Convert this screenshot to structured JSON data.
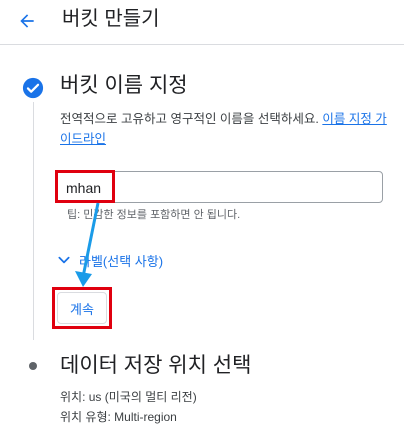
{
  "header": {
    "title": "버킷 만들기",
    "back_icon": "arrow-left-icon"
  },
  "step1": {
    "title": "버킷 이름 지정",
    "description": "전역적으로 고유하고 영구적인 이름을 선택하세요. ",
    "guide_link": "이름 지정 가이드라인",
    "input_value": "mhan",
    "tip": "팁: 민감한 정보를 포함하면 안 됩니다.",
    "labels_toggle": "라벨(선택 사항)",
    "continue_label": "계속",
    "status_icon": "check-circle-icon"
  },
  "step2": {
    "title": "데이터 저장 위치 선택",
    "location": "위치: us (미국의 멀티 리전)",
    "location_type": "위치 유형: Multi-region"
  },
  "colors": {
    "accent": "#1a73e8",
    "highlight": "#e0000f",
    "annotation_arrow": "#1a9be8",
    "text": "#202124"
  }
}
